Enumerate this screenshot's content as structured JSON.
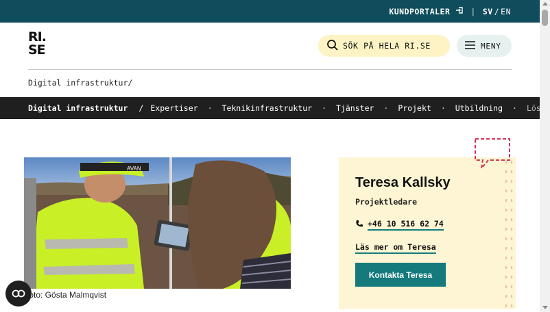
{
  "topbar": {
    "customer_portals": "KUNDPORTALER",
    "separator": "|",
    "lang_active": "SV",
    "lang_slash": "/",
    "lang_other": "EN"
  },
  "header": {
    "logo_line1": "RI.",
    "logo_line2": "SE",
    "search_placeholder": "SÖK PÅ HELA RI.SE",
    "menu_label": "MENY"
  },
  "breadcrumb": "Digital infrastruktur/",
  "section_nav": {
    "home": "Digital infrastruktur",
    "slash": "/",
    "items": [
      "Expertiser",
      "Teknikinfrastruktur",
      "Tjänster",
      "Projekt",
      "Utbildning",
      "Lösnin"
    ]
  },
  "photo": {
    "caption": "Foto: Gösta Malmqvist",
    "helmet_text": "AVAN"
  },
  "contact": {
    "name": "Teresa Kallsky",
    "role": "Projektledare",
    "phone": "+46 10 516 62 74",
    "read_more": "Läs mer om Teresa",
    "cta": "Kontakta Teresa"
  },
  "colors": {
    "topbar": "#0f4c5c",
    "search_bg": "#fdf3c4",
    "menu_bg": "#e6f1ef",
    "nav_bg": "#1f1f1f",
    "card_bg": "#fdf5d3",
    "accent": "#157a7c",
    "bubble": "#d2335a"
  },
  "icons": [
    "login-icon",
    "search-icon",
    "hamburger-icon",
    "phone-icon",
    "speech-bubble-icon",
    "cookie-settings-icon"
  ]
}
